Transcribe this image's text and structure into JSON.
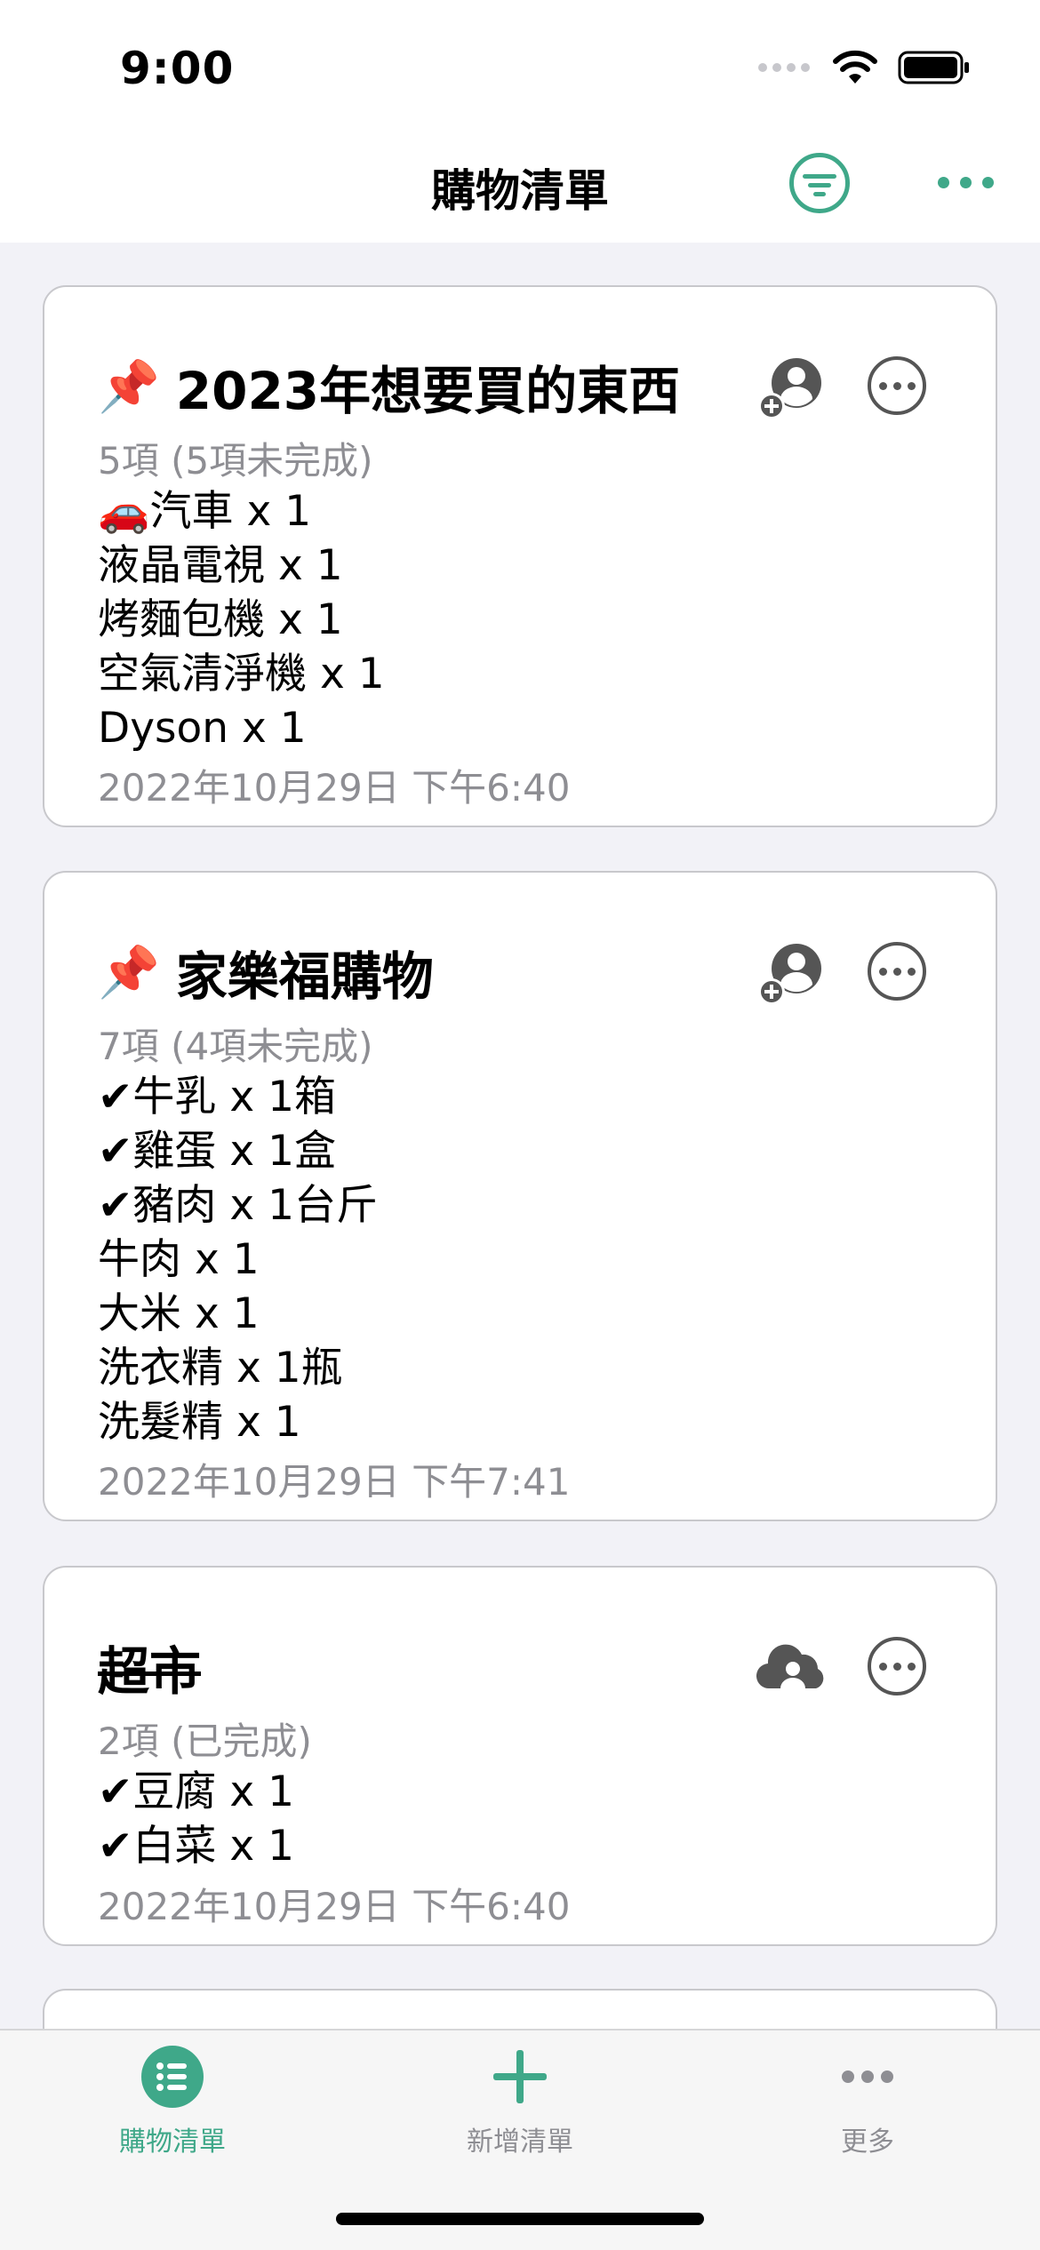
{
  "status_bar": {
    "time": "9:00"
  },
  "nav": {
    "title": "購物清單"
  },
  "lists": [
    {
      "title": "2023年想要買的東西",
      "pinned": true,
      "strikethrough": false,
      "share_icon": "person-add-icon",
      "count": "5項 (5項未完成)",
      "items": [
        "🚗汽車 x 1",
        "液晶電視 x 1",
        "烤麵包機 x 1",
        "空氣清淨機 x 1",
        "Dyson x 1"
      ],
      "date": "2022年10月29日 下午6:40"
    },
    {
      "title": "家樂福購物",
      "pinned": true,
      "strikethrough": false,
      "share_icon": "person-add-icon",
      "count": "7項 (4項未完成)",
      "items": [
        "✔牛乳 x 1箱",
        "✔雞蛋 x 1盒",
        "✔豬肉 x 1台斤",
        "牛肉 x 1",
        "大米 x 1",
        "洗衣精 x 1瓶",
        "洗髮精 x 1"
      ],
      "date": "2022年10月29日 下午7:41"
    },
    {
      "title": "超市",
      "pinned": false,
      "strikethrough": true,
      "share_icon": "cloud-person-icon",
      "count": "2項 (已完成)",
      "items": [
        "✔豆腐 x 1",
        "✔白菜 x 1"
      ],
      "date": "2022年10月29日 下午6:40"
    }
  ],
  "tab_bar": {
    "tabs": [
      {
        "label": "購物清單",
        "icon": "list-icon",
        "active": true
      },
      {
        "label": "新增清單",
        "icon": "plus-icon",
        "active": false
      },
      {
        "label": "更多",
        "icon": "ellipsis-icon",
        "active": false
      }
    ]
  },
  "colors": {
    "accent": "#3fa889",
    "inactive": "#8e8e93",
    "card_border": "#c8c8cc",
    "background": "#f2f2f7"
  }
}
